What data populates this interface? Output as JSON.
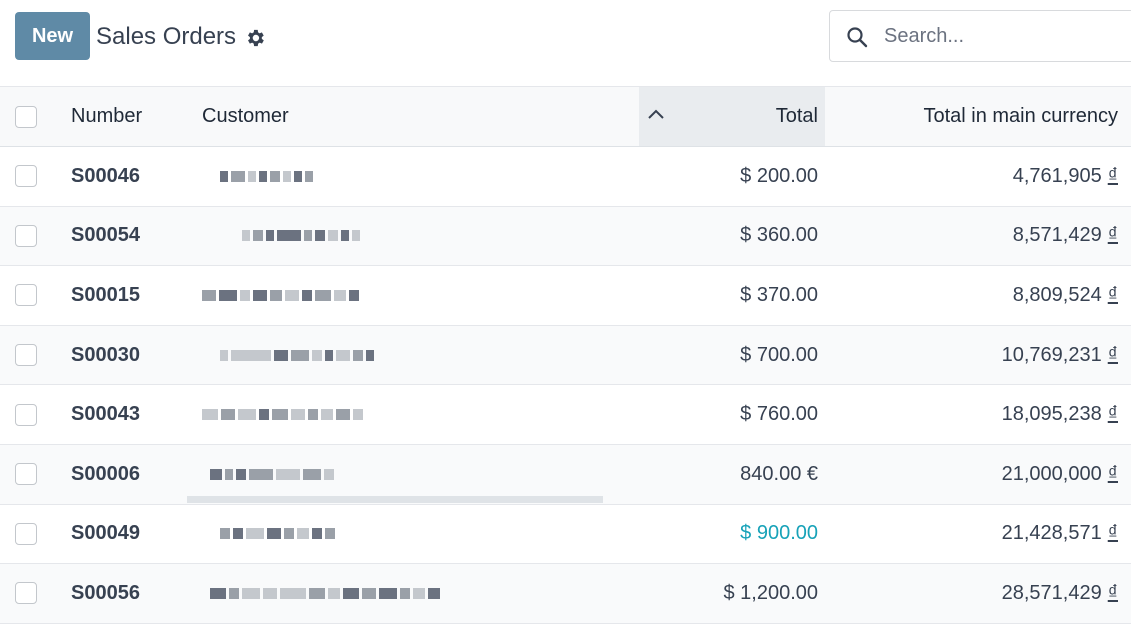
{
  "header": {
    "new_label": "New",
    "title": "Sales Orders",
    "search_placeholder": "Search..."
  },
  "columns": {
    "number": "Number",
    "customer": "Customer",
    "total": "Total",
    "main_currency": "Total in main currency"
  },
  "rows": [
    {
      "number": "S00046",
      "total": "$ 200.00",
      "main": "4,761,905",
      "sym": "₫"
    },
    {
      "number": "S00054",
      "total": "$ 360.00",
      "main": "8,571,429",
      "sym": "₫"
    },
    {
      "number": "S00015",
      "total": "$ 370.00",
      "main": "8,809,524",
      "sym": "₫"
    },
    {
      "number": "S00030",
      "total": "$ 700.00",
      "main": "10,769,231",
      "sym": "₫"
    },
    {
      "number": "S00043",
      "total": "$ 760.00",
      "main": "18,095,238",
      "sym": "₫"
    },
    {
      "number": "S00006",
      "total": "840.00 €",
      "main": "21,000,000",
      "sym": "₫"
    },
    {
      "number": "S00049",
      "total": "$ 900.00",
      "main": "21,428,571",
      "sym": "₫"
    },
    {
      "number": "S00056",
      "total": "$ 1,200.00",
      "main": "28,571,429",
      "sym": "₫"
    }
  ],
  "colors": {
    "primary": "#5f8aa6",
    "highlight": "#17a2b8"
  }
}
